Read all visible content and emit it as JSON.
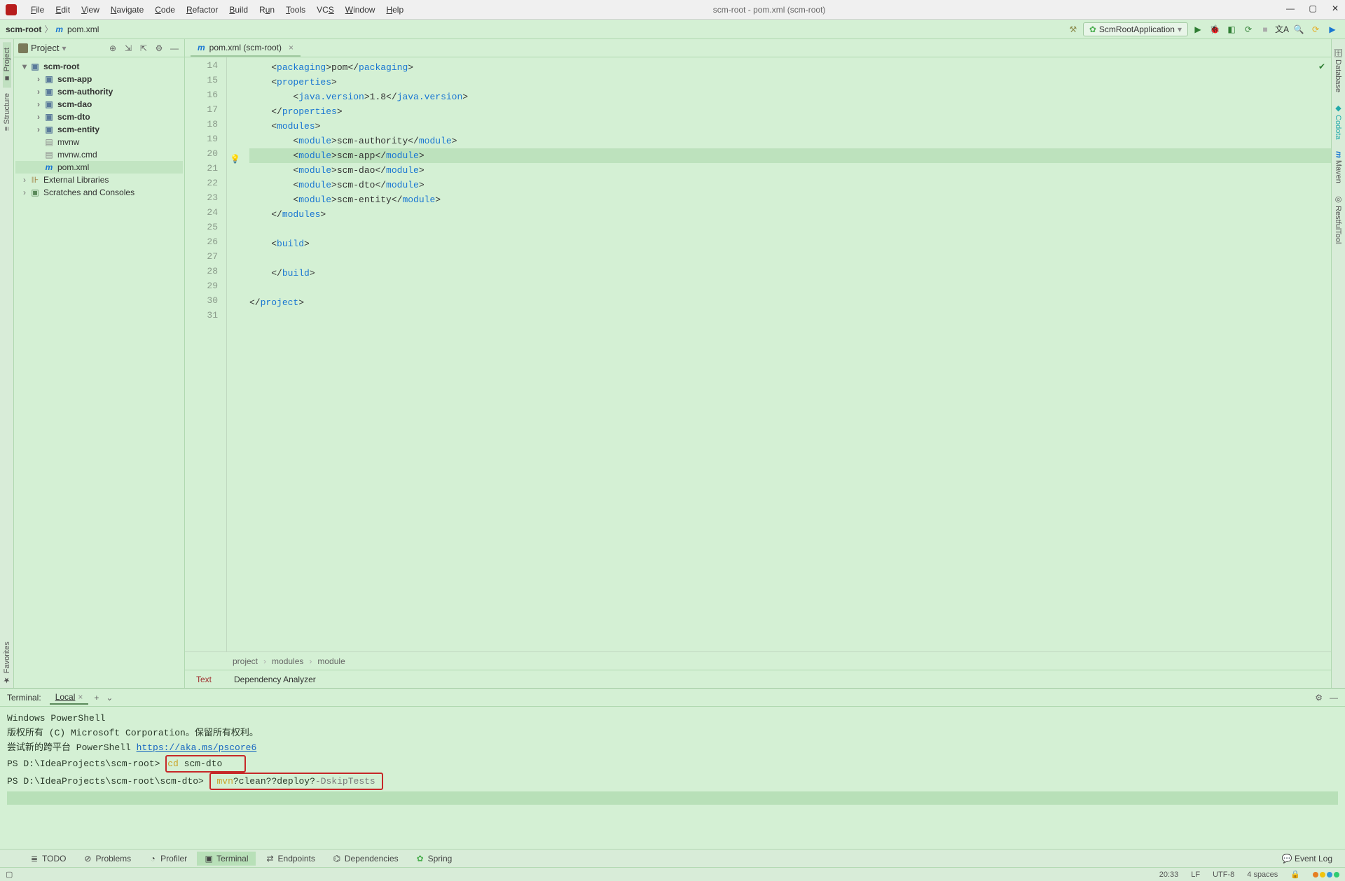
{
  "window": {
    "title": "scm-root - pom.xml (scm-root)"
  },
  "menu": {
    "file": "File",
    "edit": "Edit",
    "view": "View",
    "navigate": "Navigate",
    "code": "Code",
    "refactor": "Refactor",
    "build": "Build",
    "run": "Run",
    "tools": "Tools",
    "vcs": "VCS",
    "window": "Window",
    "help": "Help"
  },
  "navbar": {
    "bc1": "scm-root",
    "bc2": "pom.xml",
    "run_config": "ScmRootApplication"
  },
  "left_strip": {
    "project": "Project",
    "structure": "Structure"
  },
  "right_strip": {
    "database": "Database",
    "codota": "Codota",
    "maven": "Maven",
    "restful": "RestfulTool"
  },
  "project_panel": {
    "title": "Project",
    "tree": {
      "root": "scm-root",
      "app": "scm-app",
      "authority": "scm-authority",
      "dao": "scm-dao",
      "dto": "scm-dto",
      "entity": "scm-entity",
      "mvnw": "mvnw",
      "mvnwcmd": "mvnw.cmd",
      "pom": "pom.xml",
      "ext": "External Libraries",
      "scratch": "Scratches and Consoles"
    }
  },
  "editor": {
    "tab": "pom.xml (scm-root)",
    "gutter": [
      "14",
      "15",
      "16",
      "17",
      "18",
      "19",
      "20",
      "21",
      "22",
      "23",
      "24",
      "25",
      "26",
      "27",
      "28",
      "29",
      "30",
      "31"
    ],
    "trail": {
      "p1": "project",
      "p2": "modules",
      "p3": "module"
    },
    "subtabs": {
      "text": "Text",
      "dep": "Dependency Analyzer"
    }
  },
  "code": {
    "l14": {
      "pre": "    <",
      "t1": "packaging",
      "mid": ">pom</",
      "t2": "packaging",
      "post": ">"
    },
    "l15": {
      "pre": "    <",
      "t1": "properties",
      "post": ">"
    },
    "l16": {
      "pre": "        <",
      "t1": "java.version",
      "mid": ">1.8</",
      "t2": "java.version",
      "post": ">"
    },
    "l17": {
      "pre": "    </",
      "t1": "properties",
      "post": ">"
    },
    "l18": {
      "pre": "    <",
      "t1": "modules",
      "post": ">"
    },
    "l19": {
      "pre": "        <",
      "t1": "module",
      "mid": ">scm-authority</",
      "t2": "module",
      "post": ">"
    },
    "l20": {
      "pre": "        <",
      "t1": "module",
      "mid": ">scm-app</",
      "t2": "module",
      "post": ">"
    },
    "l21": {
      "pre": "        <",
      "t1": "module",
      "mid": ">scm-dao</",
      "t2": "module",
      "post": ">"
    },
    "l22": {
      "pre": "        <",
      "t1": "module",
      "mid": ">scm-dto</",
      "t2": "module",
      "post": ">"
    },
    "l23": {
      "pre": "        <",
      "t1": "module",
      "mid": ">scm-entity</",
      "t2": "module",
      "post": ">"
    },
    "l24": {
      "pre": "    </",
      "t1": "modules",
      "post": ">"
    },
    "l26": {
      "pre": "    <",
      "t1": "build",
      "post": ">"
    },
    "l28": {
      "pre": "    </",
      "t1": "build",
      "post": ">"
    },
    "l30": {
      "pre": "</",
      "t1": "project",
      "post": ">"
    }
  },
  "terminal": {
    "title": "Terminal:",
    "tab": "Local",
    "l1": "Windows PowerShell",
    "l2": "版权所有 (C) Microsoft Corporation。保留所有权利。",
    "l3a": "尝试新的跨平台 PowerShell ",
    "l3b": "https://aka.ms/pscore6",
    "l4a": "PS D:\\IdeaProjects\\scm-root> ",
    "l4b": "cd ",
    "l4c": "scm-dto",
    "l5a": "PS D:\\IdeaProjects\\scm-root\\scm-dto> ",
    "l5b": "mvn",
    "l5c": "?clean??deploy?",
    "l5d": "-DskipTests"
  },
  "bottom": {
    "todo": "TODO",
    "problems": "Problems",
    "profiler": "Profiler",
    "terminal": "Terminal",
    "endpoints": "Endpoints",
    "deps": "Dependencies",
    "spring": "Spring",
    "event": "Event Log",
    "fav": "Favorites"
  },
  "status": {
    "caret": "20:33",
    "le": "LF",
    "enc": "UTF-8",
    "indent": "4 spaces"
  }
}
